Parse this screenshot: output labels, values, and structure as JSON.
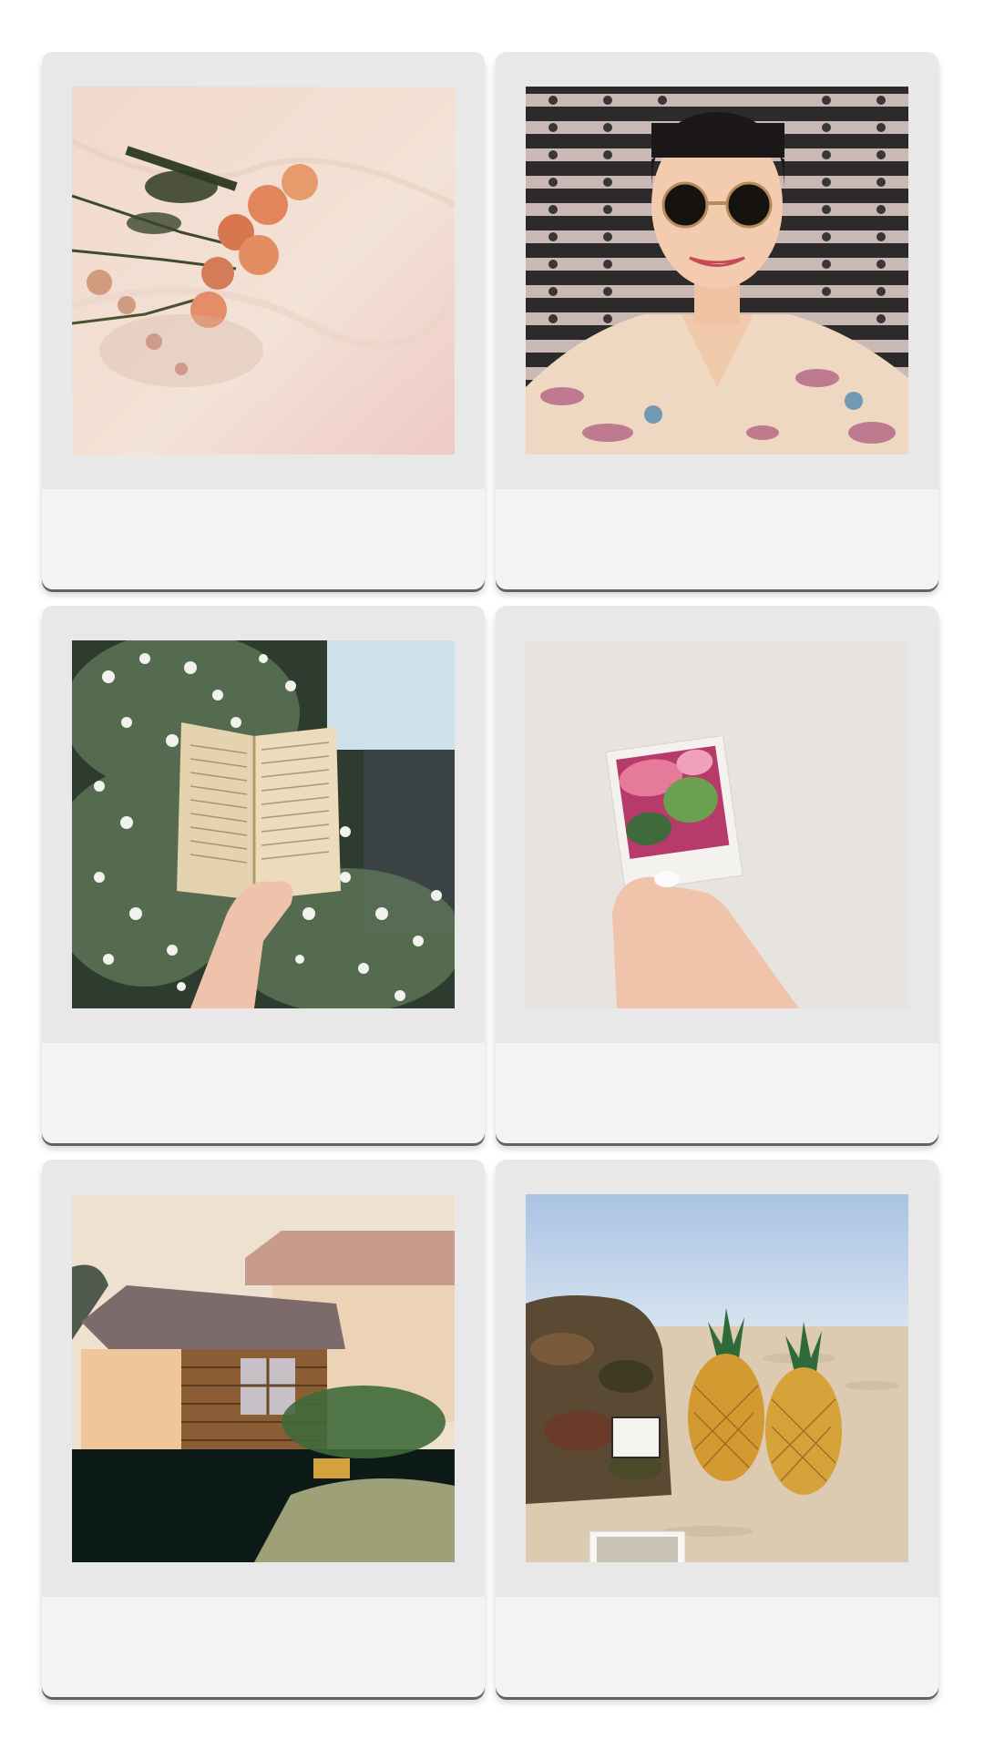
{
  "photos": [
    {
      "caption": "",
      "subject": "dried-roses-on-linen"
    },
    {
      "caption": "",
      "subject": "woman-with-sunglasses"
    },
    {
      "caption": "",
      "subject": "book-in-flowering-bush"
    },
    {
      "caption": "",
      "subject": "hand-holding-instant-photo"
    },
    {
      "caption": "",
      "subject": "garden-shed"
    },
    {
      "caption": "",
      "subject": "pineapples-on-beach"
    }
  ],
  "colors": {
    "frame": "#e8e8e8",
    "caption_strip": "#f3f3f3",
    "background": "#ffffff"
  }
}
